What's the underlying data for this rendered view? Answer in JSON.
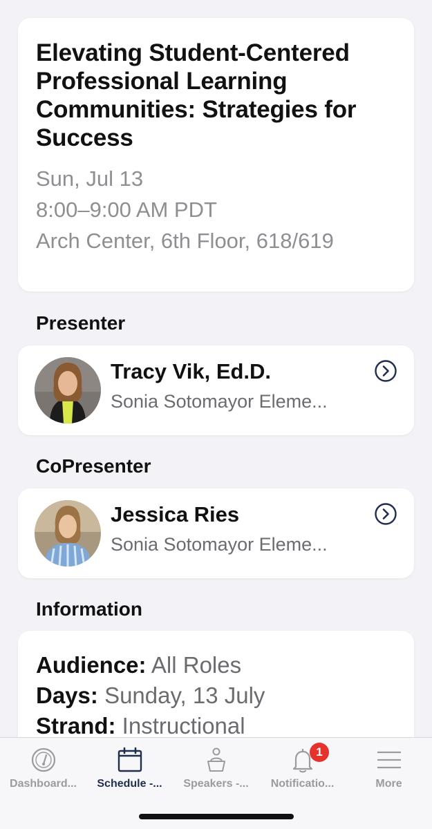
{
  "session": {
    "title": "Elevating Student-Centered Professional Learning Communities: Strategies for Success",
    "date": "Sun, Jul 13",
    "time": "8:00–9:00 AM PDT",
    "location": "Arch Center, 6th Floor, 618/619"
  },
  "presenter_section": {
    "label": "Presenter",
    "name": "Tracy Vik, Ed.D.",
    "org": "Sonia Sotomayor Eleme..."
  },
  "copresenter_section": {
    "label": "CoPresenter",
    "name": "Jessica Ries",
    "org": "Sonia Sotomayor Eleme..."
  },
  "information": {
    "label": "Information",
    "rows": [
      {
        "key": "Audience:",
        "value": "All Roles"
      },
      {
        "key": "Days:",
        "value": "Sunday, 13 July"
      },
      {
        "key": "Strand:",
        "value": "Instructional"
      }
    ]
  },
  "tabbar": {
    "tabs": [
      {
        "label": "Dashboard...",
        "icon": "gauge-icon"
      },
      {
        "label": "Schedule -...",
        "icon": "calendar-icon"
      },
      {
        "label": "Speakers -...",
        "icon": "speaker-podium-icon"
      },
      {
        "label": "Notificatio...",
        "icon": "bell-icon",
        "badge": "1"
      },
      {
        "label": "More",
        "icon": "hamburger-menu-icon"
      }
    ],
    "active_index": 1
  },
  "colors": {
    "accent": "#1f2d4e",
    "badge": "#e5322d",
    "muted": "#8e8e93",
    "background": "#f2f2f7"
  }
}
